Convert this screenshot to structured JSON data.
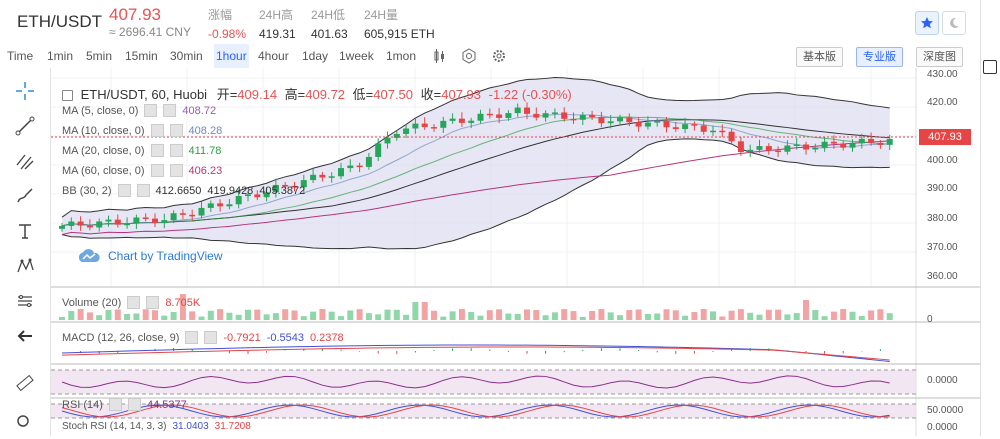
{
  "header": {
    "pair": "ETH/USDT",
    "price": "407.93",
    "cny": "≈ 2696.41 CNY",
    "stats": [
      {
        "label": "涨幅",
        "value": "-0.98%",
        "neg": true
      },
      {
        "label": "24H高",
        "value": "419.31"
      },
      {
        "label": "24H低",
        "value": "401.63"
      },
      {
        "label": "24H量",
        "value": "605,915 ETH"
      }
    ]
  },
  "toolbar": {
    "timeframes": [
      "Time",
      "1min",
      "5min",
      "15min",
      "30min",
      "1hour",
      "4hour",
      "1day",
      "1week",
      "1mon"
    ],
    "active": "1hour",
    "buttons": [
      "基本版",
      "专业版",
      "深度图"
    ],
    "active_button": "专业版"
  },
  "main": {
    "symbol": "ETH/USDT, 60, Huobi",
    "ohlc": {
      "o_label": "开=",
      "o": "409.14",
      "h_label": "高=",
      "h": "409.72",
      "l_label": "低=",
      "l": "407.50",
      "c_label": "收=",
      "c": "407.93",
      "chg": "-1.22 (-0.30%)"
    },
    "indicators": [
      {
        "name": "MA (5, close, 0)",
        "value": "408.72",
        "color": "#9b59b6"
      },
      {
        "name": "MA (10, close, 0)",
        "value": "408.28",
        "color": "#6b8bbd"
      },
      {
        "name": "MA (20, close, 0)",
        "value": "411.78",
        "color": "#2e9e45"
      },
      {
        "name": "MA (60, close, 0)",
        "value": "406.23",
        "color": "#b6357a"
      },
      {
        "name": "BB (30, 2)",
        "value": "412.6650",
        "value2": "419.9428",
        "value3": "405.3872",
        "color": "#333333"
      }
    ],
    "current_price_label": "407.93",
    "tv_link": "Chart by TradingView",
    "price_axis": [
      "430.00",
      "420.00",
      "410.00",
      "400.00",
      "390.00",
      "380.00",
      "370.00",
      "360.00"
    ]
  },
  "volume": {
    "name": "Volume (20)",
    "value": "8.705K",
    "axis": "0"
  },
  "macd": {
    "name": "MACD (12, 26, close, 9)",
    "v1": "-0.7921",
    "v2": "-0.5543",
    "v3": "0.2378",
    "axis": "0.0000"
  },
  "rsi": {
    "name": "RSI (14)",
    "value": "44.5377",
    "axis": "50.0000"
  },
  "stoch": {
    "name": "Stoch RSI (14, 14, 3, 3)",
    "v1": "31.0403",
    "v2": "31.7208",
    "axis": "0.0000"
  },
  "colors": {
    "up": "#26a65b",
    "down": "#e64545",
    "accent": "#2962ff",
    "band": "#d9d9f0"
  }
}
